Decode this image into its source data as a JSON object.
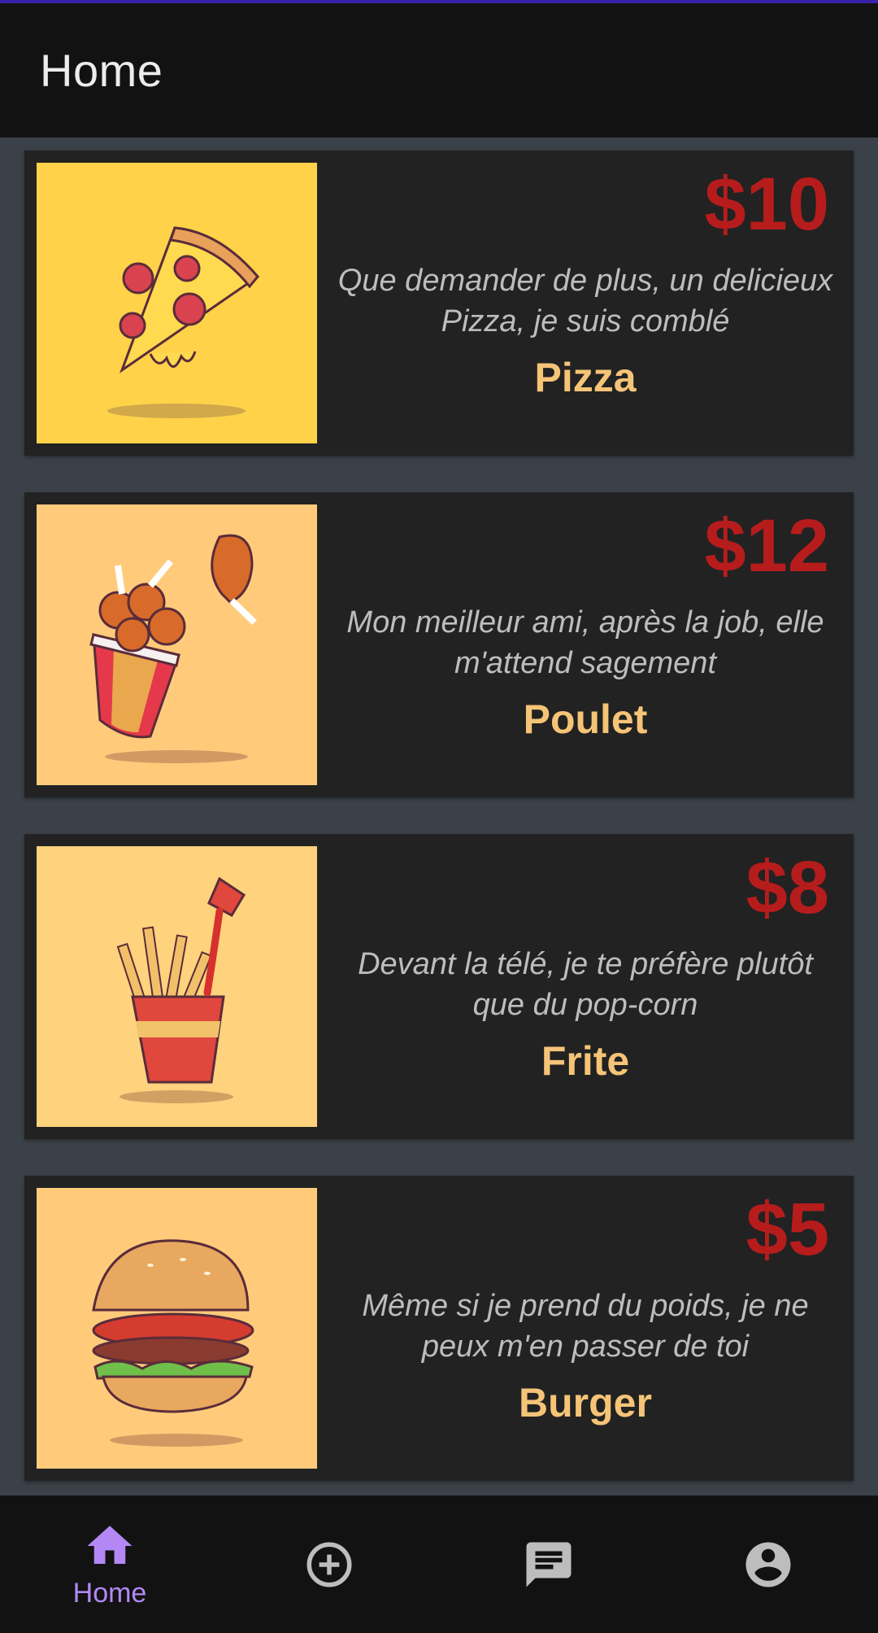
{
  "appbar": {
    "title": "Home"
  },
  "items": [
    {
      "price": "$10",
      "description": "Que demander de plus, un delicieux Pizza, je suis comblé",
      "name": "Pizza",
      "image_icon": "pizza-illustration",
      "image_bg": "#ffd24a"
    },
    {
      "price": "$12",
      "description": "Mon meilleur ami, après la job, elle m'attend sagement",
      "name": "Poulet",
      "image_icon": "chicken-bucket-illustration",
      "image_bg": "#ffcb7b"
    },
    {
      "price": "$8",
      "description": "Devant la télé, je te préfère plutôt que du pop-corn",
      "name": "Frite",
      "image_icon": "fries-illustration",
      "image_bg": "#ffd27d"
    },
    {
      "price": "$5",
      "description": "Même si je prend du poids, je ne peux m'en passer de toi",
      "name": "Burger",
      "image_icon": "burger-illustration",
      "image_bg": "#ffcb7b"
    }
  ],
  "bottom_nav": {
    "items": [
      {
        "label": "Home",
        "icon": "home-icon",
        "active": true
      },
      {
        "label": "",
        "icon": "add-circle-icon",
        "active": false
      },
      {
        "label": "",
        "icon": "chat-icon",
        "active": false
      },
      {
        "label": "",
        "icon": "account-icon",
        "active": false
      }
    ]
  },
  "colors": {
    "price": "#b71c1c",
    "name": "#f5c477",
    "description": "#bdbdbd",
    "card": "#222222",
    "background": "#3b4148",
    "nav_active": "#b388f5",
    "nav_inactive": "#bdbdbd"
  }
}
